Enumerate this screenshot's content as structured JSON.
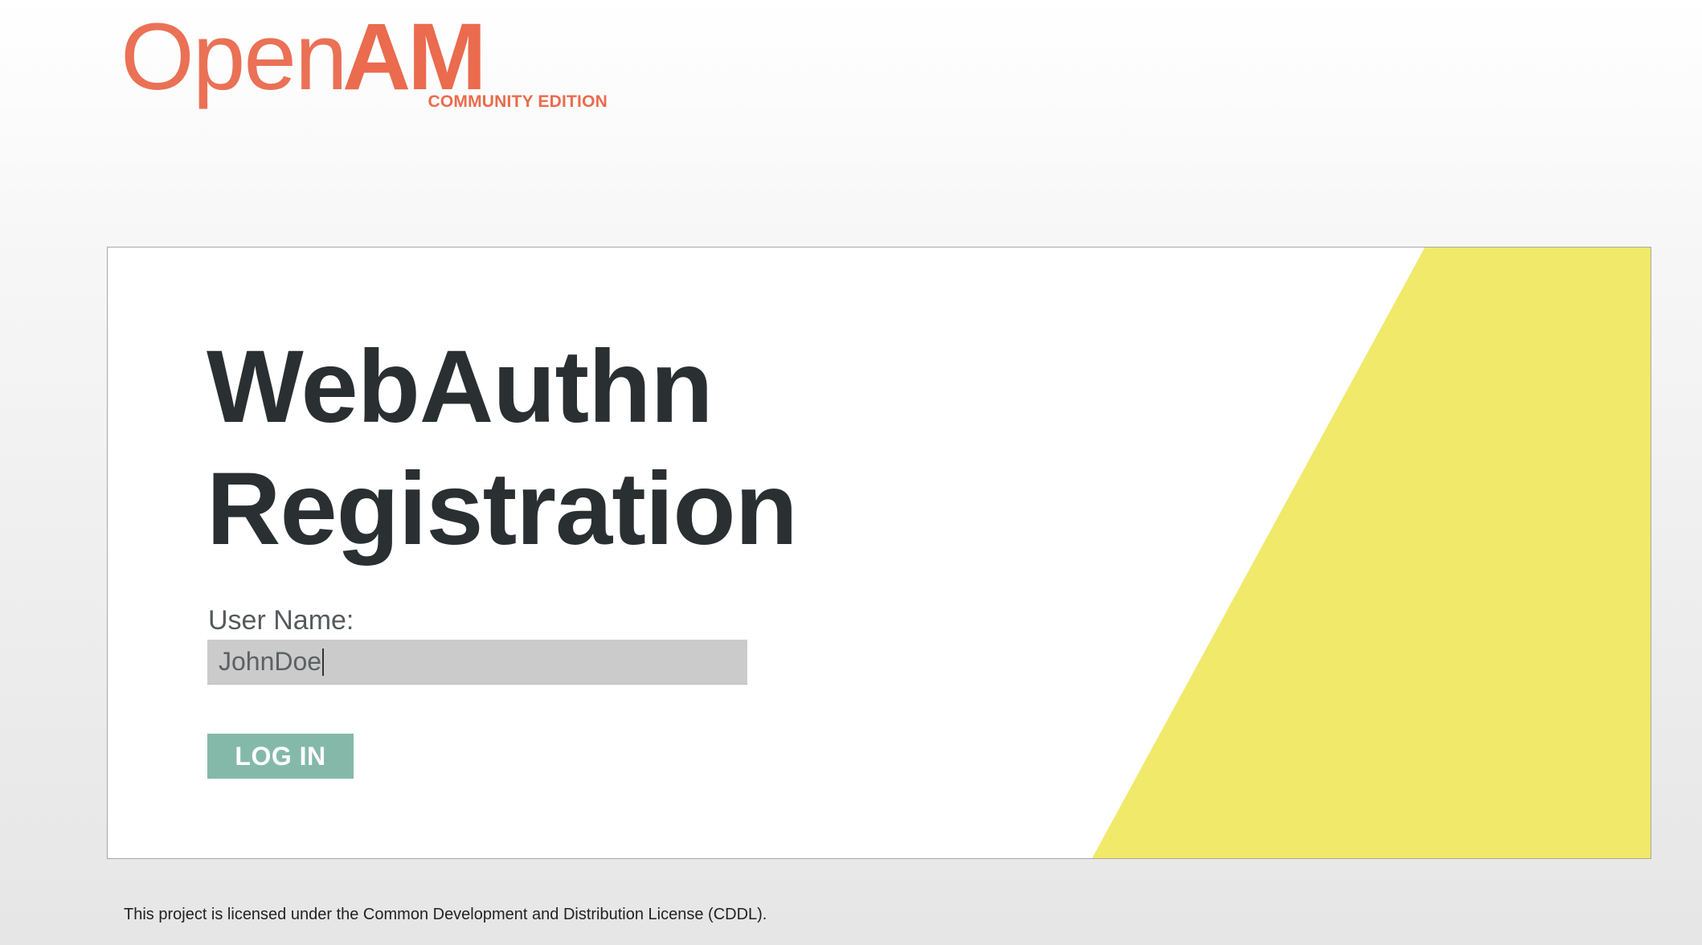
{
  "logo": {
    "open_text": "Open",
    "am_text": "AM",
    "edition_text": "COMMUNITY EDITION"
  },
  "card": {
    "title_line1": "WebAuthn",
    "title_line2": "Registration",
    "username_label": "User Name:",
    "username_value": "JohnDoe",
    "login_label": "LOG IN"
  },
  "footer": {
    "license_text": "This project is licensed under the Common Development and Distribution License (CDDL)."
  },
  "colors": {
    "brand": "#ea6b4e",
    "accent_yellow": "#f1e96a",
    "button": "#84b9a9",
    "title": "#2a2f31"
  }
}
